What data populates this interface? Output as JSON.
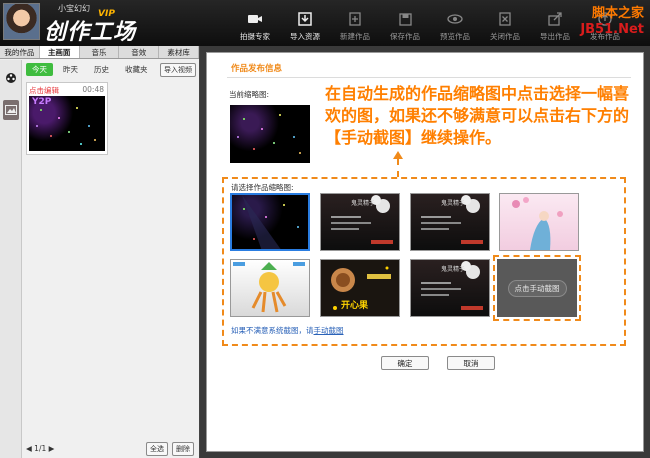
{
  "header": {
    "username": "小宝幻幻",
    "vip": "VIP",
    "logo": "创作工场",
    "watermark_top": "脚本之家",
    "watermark_bottom": "JB51.Net",
    "toolbar": [
      {
        "label": "拍摄专家",
        "icon": "camera-icon",
        "enabled": true
      },
      {
        "label": "导入资源",
        "icon": "import-icon",
        "enabled": true
      },
      {
        "label": "新建作品",
        "icon": "new-icon",
        "enabled": false
      },
      {
        "label": "保存作品",
        "icon": "save-icon",
        "enabled": false
      },
      {
        "label": "预览作品",
        "icon": "eye-icon",
        "enabled": false
      },
      {
        "label": "关闭作品",
        "icon": "close-icon",
        "enabled": false
      },
      {
        "label": "导出作品",
        "icon": "export-icon",
        "enabled": false
      },
      {
        "label": "发布作品",
        "icon": "publish-icon",
        "enabled": false
      }
    ]
  },
  "left": {
    "tabs": [
      "我的作品",
      "主画面",
      "音乐",
      "音效",
      "素材库"
    ],
    "active_tab": 1,
    "filters": [
      "今天",
      "昨天",
      "历史",
      "收藏夹"
    ],
    "active_filter": 0,
    "import_label": "导入视频",
    "card": {
      "title": "点击编辑",
      "time": "00:48",
      "tag": "Y2P"
    },
    "pager": "1/1",
    "select_all_label": "全选",
    "delete_label": "删除"
  },
  "right": {
    "title": "作品发布信息",
    "current_thumb_label": "当前缩略图:",
    "annotation": "在自动生成的作品缩略图中点击选择一幅喜欢的图，如果还不够满意可以点击右下方的【手动截图】继续操作。",
    "choose_label": "请选择作品缩略图:",
    "thumbs": [
      {
        "style": "stage",
        "text": ""
      },
      {
        "style": "dark-flower",
        "text": "鬼灵精子"
      },
      {
        "style": "dark-flower",
        "text": "鬼灵精子"
      },
      {
        "style": "pink-girl",
        "text": ""
      },
      {
        "style": "cartoon",
        "text": ""
      },
      {
        "style": "cake",
        "text": "开心果"
      },
      {
        "style": "dark-flower",
        "text": "鬼灵精子"
      }
    ],
    "manual_label": "点击手动截图",
    "hint_prefix": "如果不满意系统截图，请",
    "hint_link": "手动截图",
    "ok_label": "确定",
    "cancel_label": "取消"
  },
  "colors": {
    "accent": "#f08a1a",
    "selected_border": "#2a7de1",
    "link": "#2a62b8",
    "filter_active": "#3fbc3f"
  }
}
